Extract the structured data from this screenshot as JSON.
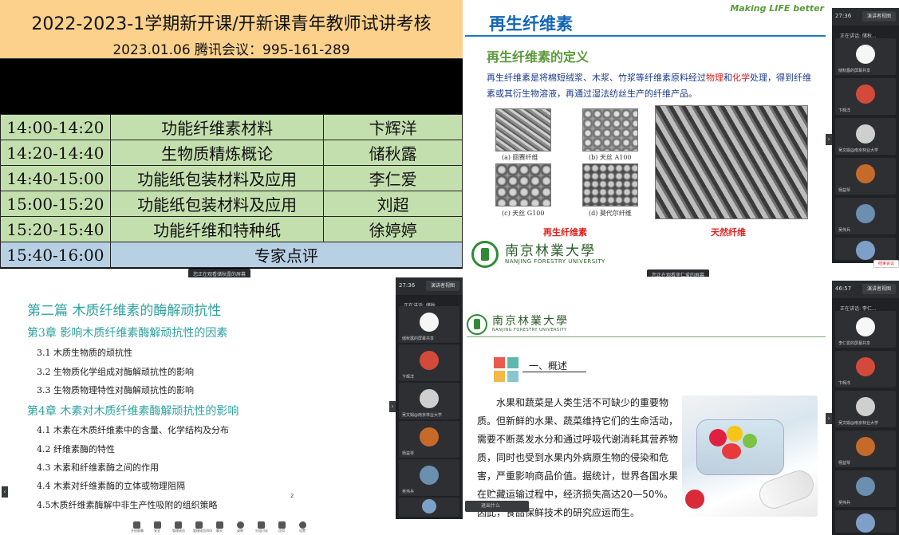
{
  "schedule": {
    "title": "2022-2023-1学期新开课/开新课青年教师试讲考核",
    "subtitle": "2023.01.06 腾讯会议：995-161-289",
    "rows": [
      {
        "time": "14:00-14:20",
        "course": "功能纤维素材料",
        "teacher": "卞辉洋"
      },
      {
        "time": "14:20-14:40",
        "course": "生物质精炼概论",
        "teacher": "储秋露"
      },
      {
        "time": "14:40-15:00",
        "course": "功能纸包装材料及应用",
        "teacher": "李仁爱"
      },
      {
        "time": "15:00-15:20",
        "course": "功能纸包装材料及应用",
        "teacher": "刘超"
      },
      {
        "time": "15:20-15:40",
        "course": "功能纤维和特种纸",
        "teacher": "徐婷婷"
      },
      {
        "time": "15:40-16:00",
        "course": "专家点评",
        "teacher": ""
      }
    ],
    "share_label": "您正在观看储秋露的屏幕"
  },
  "slide2": {
    "title": "再生纤维素",
    "brand": "Making LIFE better",
    "subtitle": "再生纤维素的定义",
    "text_a": "再生纤维素是将棉短绒浆、木浆、竹浆等纤维素原料经过",
    "text_red1": "物理",
    "text_b": "和",
    "text_red2": "化学",
    "text_c": "处理，得到纤维素或其衍生物溶液，再通过湿法纺丝生产的纤维产品。",
    "captions": [
      "(a) 丽赛纤维",
      "(b) 天丝 A100",
      "(c) 天丝 G100",
      "(d) 莫代尔纤维"
    ],
    "label_regen": "再生纤维素",
    "label_natural": "天然纤维",
    "logo_cn": "南京林業大學",
    "logo_en": "NANJING FORESTRY UNIVERSITY",
    "share_label": "您正在观看李仁爱的屏幕",
    "exit_btn": "结束会议"
  },
  "sidebar2": {
    "time": "27:36",
    "view": "演讲者视图",
    "speaking": "正在讲话: 储秋...",
    "tiles": [
      {
        "name": "储秋露的屏幕共享",
        "color": "#f6f6f6"
      },
      {
        "name": "卞辉洋",
        "color": "#d44a3a"
      },
      {
        "name": "吴文娟@南京林业大学",
        "color": "#cfcfcf"
      },
      {
        "name": "杨益琴",
        "color": "#c66a2a"
      },
      {
        "name": "吴伟兵",
        "color": "#6b8fb0"
      },
      {
        "name": "",
        "color": "#7ea0c8"
      }
    ]
  },
  "slide3": {
    "title": "第二篇 木质纤维素的酶解顽抗性",
    "ch3": "第3章 影响木质纤维素酶解顽抗性的因素",
    "items3": [
      "3.1 木质生物质的顽抗性",
      "3.2 生物质化学组成对酶解顽抗性的影响",
      "3.3 生物质物理特性对酶解顽抗性的影响"
    ],
    "ch4": "第4章 木素对木质纤维素酶解顽抗性的影响",
    "items4": [
      "4.1 木素在木质纤维素中的含量、化学结构及分布",
      "4.2 纤维素酶的特性",
      "4.3 木素和纤维素酶之间的作用",
      "4.4 木素对纤维素酶的立体或物理阻隔",
      "4.5木质纤维素酶解中非生产性吸附的组织策略"
    ],
    "page": "2",
    "toolbar": [
      "开启屏幕",
      "安全",
      "管理成员",
      "管理成员(60)",
      "聊天",
      "录制",
      "分组讨论",
      "应用",
      "表情",
      "设置"
    ]
  },
  "sidebar3": {
    "time": "27:36",
    "view": "演讲者视图",
    "speaking": "正在讲话: 储秋...",
    "tiles": [
      {
        "name": "储秋露的屏幕共享",
        "color": "#f6f6f6"
      },
      {
        "name": "卞辉洋",
        "color": "#d44a3a"
      },
      {
        "name": "吴文娟@南京林业大学",
        "color": "#cfcfcf"
      },
      {
        "name": "杨益琴",
        "color": "#c66a2a"
      },
      {
        "name": "吴伟兵",
        "color": "#6b8fb0"
      },
      {
        "name": "",
        "color": "#7ea0c8"
      }
    ]
  },
  "slide4": {
    "logo_cn": "南京林業大學",
    "logo_en": "NANJING FORESTRY UNIVERSITY",
    "heading": "一、概述",
    "para": "水果和蔬菜是人类生活不可缺少的重要物质。但新鲜的水果、蔬菜维持它们的生命活动，需要不断蒸发水分和通过呼吸代谢消耗其营养物质，同时也受到水果内外病原生物的侵染和危害，严重影响商品价值。据统计，世界各国水果在贮藏运输过程中，经济损失高达20—50%。因此，食品保鲜技术的研究应运而生。",
    "bar": "退出什么"
  },
  "sidebar4": {
    "time": "46:57",
    "view": "演讲者视图",
    "speaking": "正在讲话: 李仁...",
    "tiles": [
      {
        "name": "李仁爱的屏幕共享",
        "color": "#f6f6f6"
      },
      {
        "name": "卞辉洋",
        "color": "#d44a3a"
      },
      {
        "name": "吴文娟@南京林业大学",
        "color": "#cfcfcf"
      },
      {
        "name": "杨益琴",
        "color": "#c66a2a"
      },
      {
        "name": "吴伟兵",
        "color": "#6b8fb0"
      },
      {
        "name": "",
        "color": "#7ea0c8"
      }
    ]
  },
  "colors": {
    "header_bg": "#fbd18c",
    "cell_green": "#c4dfae",
    "cell_blue": "#b8d0e4",
    "slide_blue": "#1466b6",
    "slide_green": "#5a9a3a",
    "teal": "#2ea2a0"
  }
}
